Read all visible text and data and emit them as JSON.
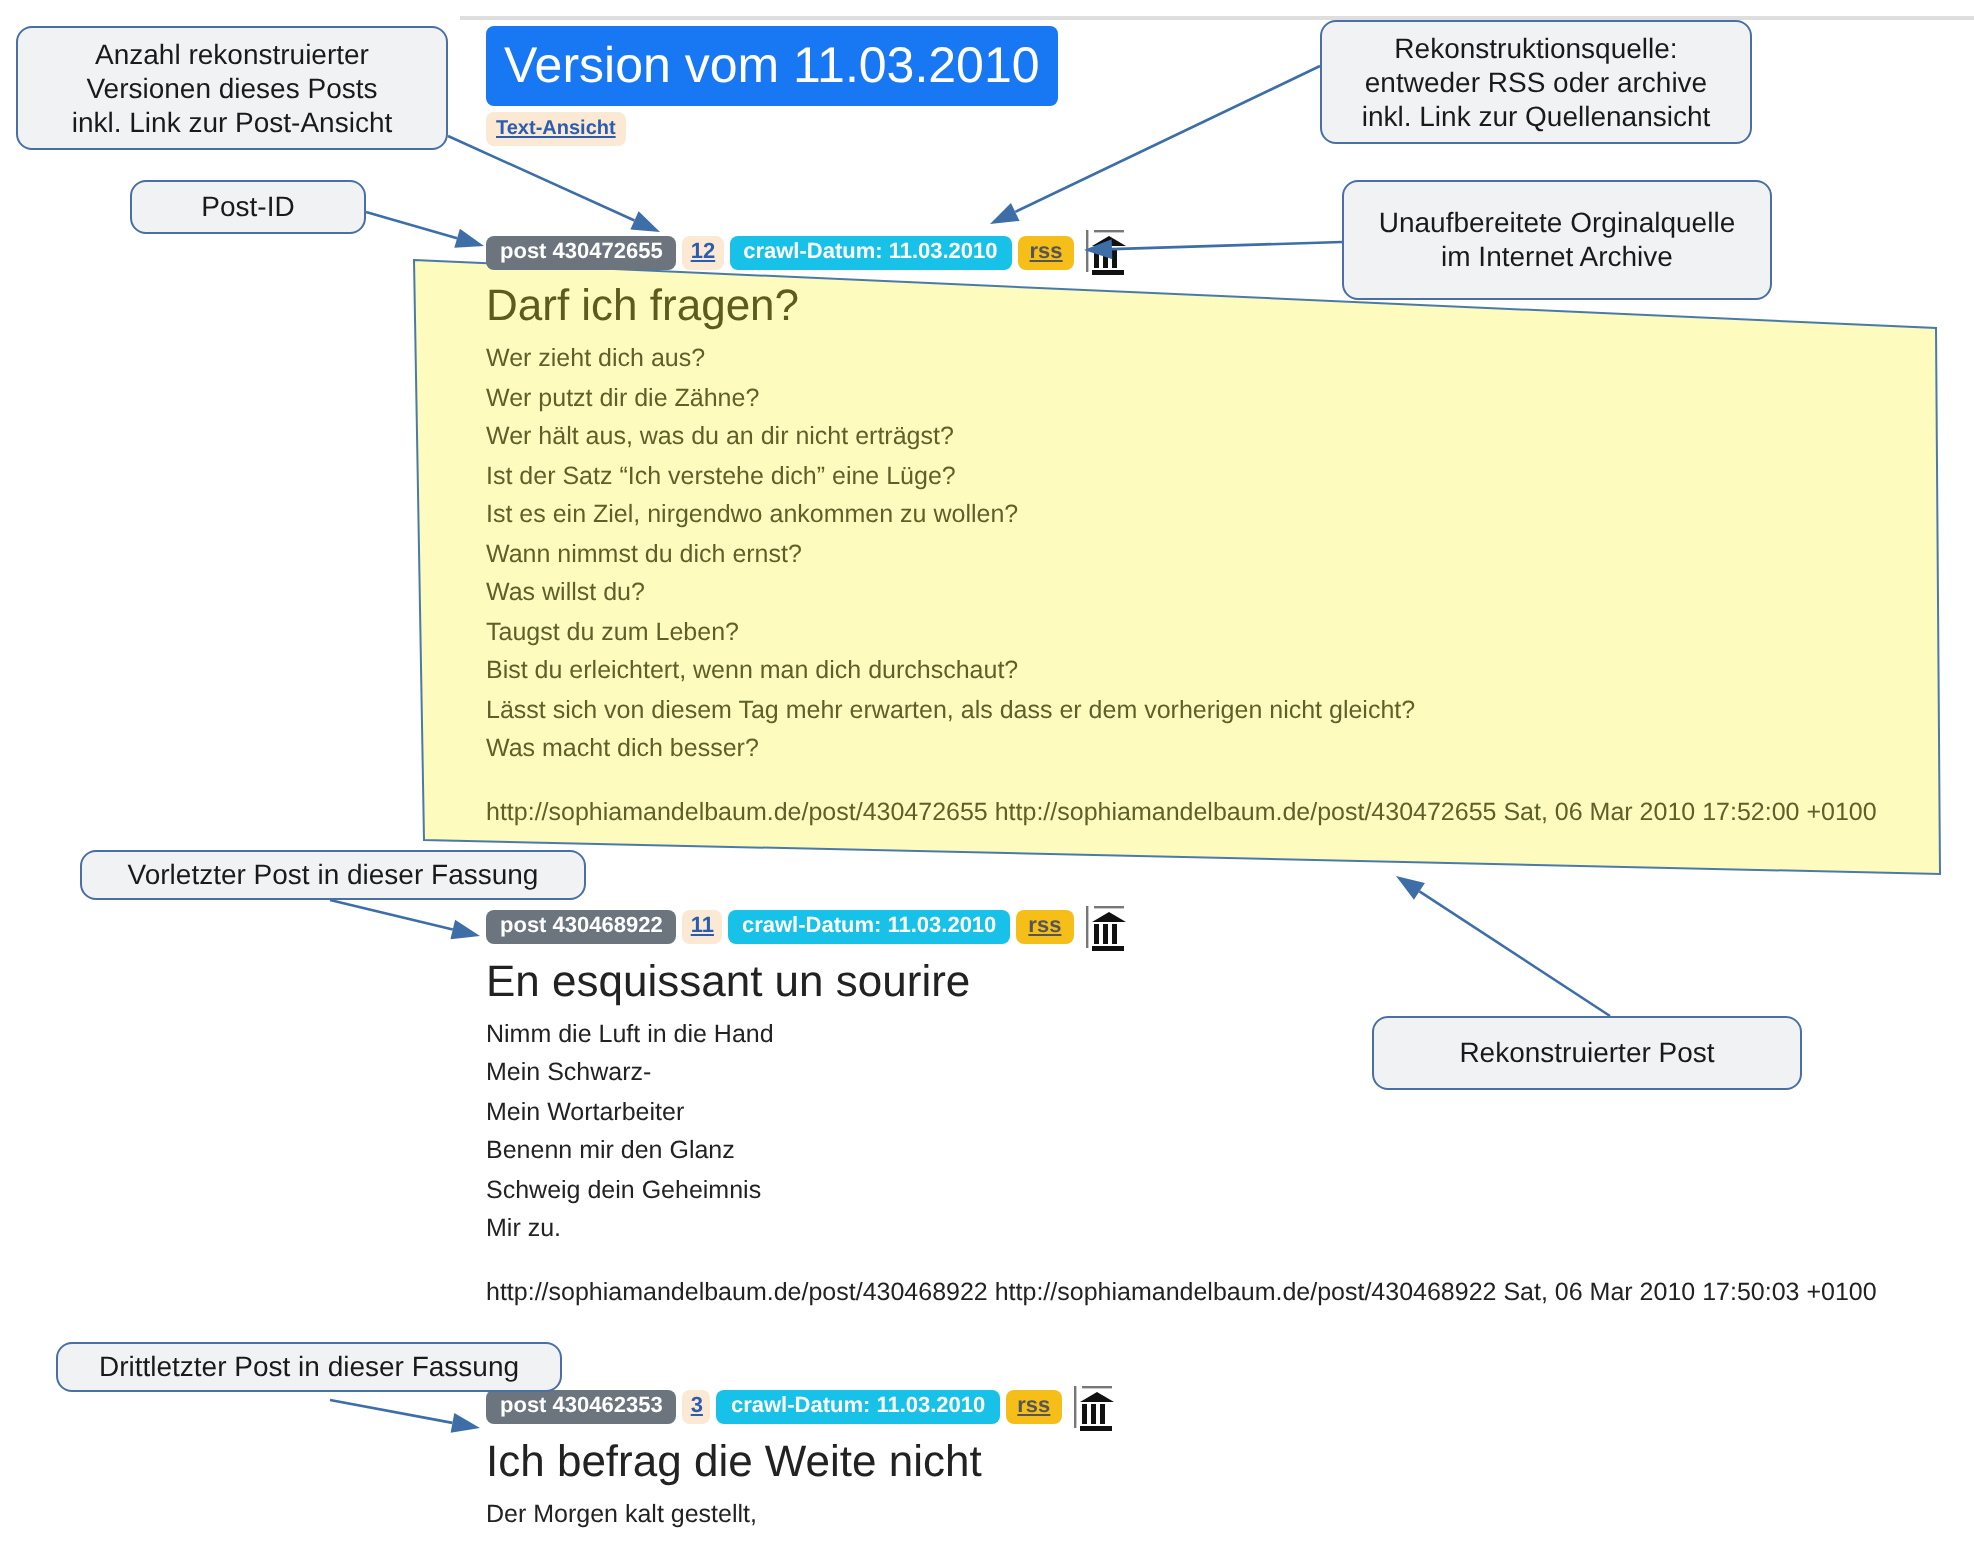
{
  "page_title": "Version vom 11.03.2010",
  "text_view_link": "Text-Ansicht",
  "posts": [
    {
      "post_id": "post 430472655",
      "version_count": "12",
      "crawl_date": "crawl-Datum: 11.03.2010",
      "source": "rss",
      "title": "Darf ich fragen?",
      "highlighted": true,
      "lines": [
        "Wer zieht dich aus?",
        "Wer putzt dir die Zähne?",
        "Wer hält aus, was du an dir nicht erträgst?",
        "Ist der Satz “Ich verstehe dich” eine Lüge?",
        "Ist es ein Ziel, nirgendwo ankommen zu wollen?",
        "Wann nimmst du dich ernst?",
        "Was willst du?",
        "Taugst du zum Leben?",
        "Bist du erleichtert, wenn man dich durchschaut?",
        "Lässt sich von diesem Tag mehr erwarten, als dass er dem vorherigen nicht gleicht?",
        "Was macht dich besser?"
      ],
      "footer": "http://sophiamandelbaum.de/post/430472655 http://sophiamandelbaum.de/post/430472655 Sat, 06 Mar 2010 17:52:00 +0100"
    },
    {
      "post_id": "post 430468922",
      "version_count": "11",
      "crawl_date": "crawl-Datum: 11.03.2010",
      "source": "rss",
      "title": "En esquissant un sourire",
      "highlighted": false,
      "lines": [
        "Nimm die Luft in die Hand",
        "Mein Schwarz-",
        "Mein Wortarbeiter",
        "Benenn mir den Glanz",
        "Schweig dein Geheimnis",
        "Mir zu."
      ],
      "footer": "http://sophiamandelbaum.de/post/430468922 http://sophiamandelbaum.de/post/430468922 Sat, 06 Mar 2010 17:50:03 +0100"
    },
    {
      "post_id": "post 430462353",
      "version_count": "3",
      "crawl_date": "crawl-Datum: 11.03.2010",
      "source": "rss",
      "title": "Ich befrag die Weite nicht",
      "highlighted": false,
      "lines": [
        "Der Morgen kalt gestellt,"
      ]
    }
  ],
  "annotations": [
    {
      "text": "Anzahl rekonstruierter\nVersionen dieses Posts\ninkl. Link zur Post-Ansicht"
    },
    {
      "text": "Post-ID"
    },
    {
      "text": "Rekonstruktionsquelle:\nentweder RSS oder archive\ninkl. Link zur Quellenansicht"
    },
    {
      "text": "Unaufbereitete Orginalquelle\nim Internet Archive"
    },
    {
      "text": "Vorletzter Post in dieser Fassung"
    },
    {
      "text": "Rekonstruierter Post"
    },
    {
      "text": "Drittletzter Post in dieser Fassung"
    }
  ]
}
